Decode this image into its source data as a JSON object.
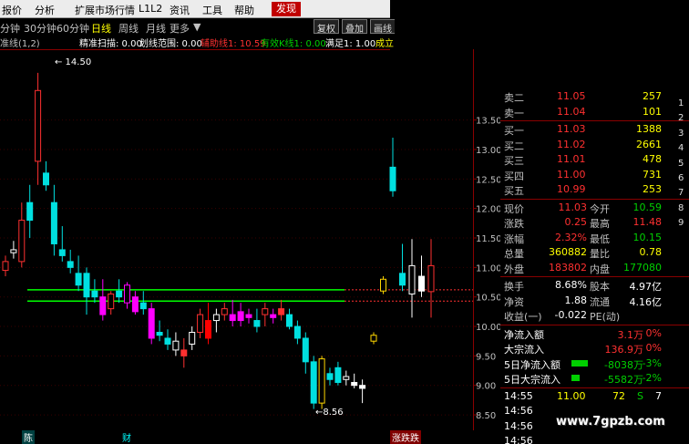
{
  "menu": [
    "报价",
    "分析",
    "扩展市场行情",
    "L1L2",
    "资讯",
    "工具",
    "帮助",
    "发现"
  ],
  "periods": [
    "分钟",
    "30分钟",
    "60分钟",
    "日线",
    "周线",
    "月线",
    "更多"
  ],
  "period_active": "日线",
  "toolbar": [
    "复权",
    "叠加",
    "画线"
  ],
  "indicator_bar": [
    {
      "text": "准线(1,2)",
      "color": "#c0c0c0"
    },
    {
      "text": "精准扫描: 0.00",
      "color": "#ffffff"
    },
    {
      "text": "划线范围: 0.00",
      "color": "#ffffff"
    },
    {
      "text": "辅助线1: 10.59",
      "color": "#ff3030"
    },
    {
      "text": "有效K线1: 0.00",
      "color": "#00d000"
    },
    {
      "text": "满足1: 1.00",
      "color": "#ffffff"
    },
    {
      "text": "成立",
      "color": "#ffff00"
    }
  ],
  "price_scale": [
    "13.50",
    "13.00",
    "12.50",
    "12.00",
    "11.50",
    "11.00",
    "10.50",
    "10.00",
    "9.50",
    "9.00",
    "8.50"
  ],
  "chart_labels": {
    "high": "14.50",
    "low": "8.56"
  },
  "quote": {
    "sell": [
      {
        "label": "卖二",
        "price": "11.05",
        "vol": "257"
      },
      {
        "label": "卖一",
        "price": "11.04",
        "vol": "101"
      }
    ],
    "buy": [
      {
        "label": "买一",
        "price": "11.03",
        "vol": "1388"
      },
      {
        "label": "买二",
        "price": "11.02",
        "vol": "2661"
      },
      {
        "label": "买三",
        "price": "11.01",
        "vol": "478"
      },
      {
        "label": "买四",
        "price": "11.00",
        "vol": "731"
      },
      {
        "label": "买五",
        "price": "10.99",
        "vol": "253"
      }
    ],
    "stats": [
      {
        "l1": "现价",
        "v1": "11.03",
        "c1": "#ff3030",
        "l2": "今开",
        "v2": "10.59",
        "c2": "#00d000"
      },
      {
        "l1": "涨跌",
        "v1": "0.25",
        "c1": "#ff3030",
        "l2": "最高",
        "v2": "11.48",
        "c2": "#ff3030"
      },
      {
        "l1": "涨幅",
        "v1": "2.32%",
        "c1": "#ff3030",
        "l2": "最低",
        "v2": "10.15",
        "c2": "#00d000"
      },
      {
        "l1": "总量",
        "v1": "360882",
        "c1": "#ffff00",
        "l2": "量比",
        "v2": "0.78",
        "c2": "#ffff00"
      },
      {
        "l1": "外盘",
        "v1": "183802",
        "c1": "#ff3030",
        "l2": "内盘",
        "v2": "177080",
        "c2": "#00d000"
      }
    ],
    "stats2": [
      {
        "l1": "换手",
        "v1": "8.68%",
        "c1": "#ffffff",
        "l2": "股本",
        "v2": "4.97亿",
        "c2": "#ffffff"
      },
      {
        "l1": "净资",
        "v1": "1.88",
        "c1": "#ffffff",
        "l2": "流通",
        "v2": "4.16亿",
        "c2": "#ffffff"
      },
      {
        "l1": "收益(一)",
        "v1": "-0.022",
        "c1": "#ffffff",
        "l2": "PE(动)",
        "v2": "",
        "c2": "#ffffff"
      }
    ],
    "flows": [
      {
        "label": "净流入额",
        "value": "3.1万",
        "pct": "0%",
        "color": "#ff3030",
        "bar": 0
      },
      {
        "label": "大宗流入",
        "value": "136.9万",
        "pct": "0%",
        "color": "#ff3030",
        "bar": 0
      },
      {
        "label": "5日净流入额",
        "value": "-8038万",
        "pct": "-3%",
        "color": "#00d000",
        "bar": 0.6
      },
      {
        "label": "5日大宗流入",
        "value": "-5582万",
        "pct": "-2%",
        "color": "#00d000",
        "bar": 0.3
      }
    ],
    "ticks": [
      {
        "time": "14:55",
        "price": "11.00",
        "vol": "72",
        "dir": "S",
        "count": "7"
      },
      {
        "time": "14:56",
        "price": "",
        "vol": "",
        "dir": "",
        "count": ""
      },
      {
        "time": "14:56",
        "price": "",
        "vol": "",
        "dir": "",
        "count": ""
      },
      {
        "time": "14:56",
        "price": "",
        "vol": "",
        "dir": "",
        "count": ""
      },
      {
        "time": "14:56",
        "price": "",
        "vol": "",
        "dir": "",
        "count": ""
      }
    ]
  },
  "right_edge": [
    "1",
    "2",
    "3",
    "4",
    "5",
    "6",
    "7",
    "8",
    "9"
  ],
  "bottom": [
    "陈",
    "财",
    "涨跌跌"
  ],
  "watermark": "www.7gpzb.com",
  "chart_data": {
    "type": "candlestick",
    "ylim": [
      8.3,
      14.7
    ],
    "hlines": [
      {
        "value": 10.62,
        "color": "#00ff00"
      },
      {
        "value": 10.43,
        "color": "#00ff00"
      }
    ],
    "candles": [
      {
        "o": 10.95,
        "h": 11.2,
        "l": 10.85,
        "c": 11.1,
        "col": "#ff3030"
      },
      {
        "o": 11.25,
        "h": 11.45,
        "l": 11.15,
        "c": 11.3,
        "col": "#ffffff"
      },
      {
        "o": 11.1,
        "h": 12.1,
        "l": 11.0,
        "c": 11.8,
        "col": "#ff3030"
      },
      {
        "o": 12.1,
        "h": 12.4,
        "l": 11.5,
        "c": 11.8,
        "col": "#00e0e0"
      },
      {
        "o": 12.8,
        "h": 14.3,
        "l": 12.4,
        "c": 14.0,
        "col": "#ff3030"
      },
      {
        "o": 12.6,
        "h": 12.8,
        "l": 12.3,
        "c": 12.4,
        "col": "#00e0e0"
      },
      {
        "o": 12.1,
        "h": 12.4,
        "l": 11.2,
        "c": 11.4,
        "col": "#00e0e0"
      },
      {
        "o": 11.3,
        "h": 11.7,
        "l": 11.1,
        "c": 11.2,
        "col": "#00e0e0"
      },
      {
        "o": 11.1,
        "h": 11.3,
        "l": 10.9,
        "c": 11.0,
        "col": "#00e0e0"
      },
      {
        "o": 10.9,
        "h": 11.2,
        "l": 10.6,
        "c": 10.7,
        "col": "#00e0e0"
      },
      {
        "o": 10.9,
        "h": 11.0,
        "l": 10.2,
        "c": 10.5,
        "col": "#00e0e0"
      },
      {
        "o": 10.6,
        "h": 10.8,
        "l": 10.4,
        "c": 10.5,
        "col": "#00e0e0"
      },
      {
        "o": 10.5,
        "h": 10.8,
        "l": 10.1,
        "c": 10.2,
        "col": "#ff00ff"
      },
      {
        "o": 10.3,
        "h": 10.6,
        "l": 10.2,
        "c": 10.55,
        "col": "#ff3030"
      },
      {
        "o": 10.6,
        "h": 10.8,
        "l": 10.4,
        "c": 10.5,
        "col": "#00e0e0"
      },
      {
        "o": 10.4,
        "h": 10.75,
        "l": 10.3,
        "c": 10.7,
        "col": "#ff00ff"
      },
      {
        "o": 10.5,
        "h": 10.6,
        "l": 10.2,
        "c": 10.25,
        "col": "#ff00ff"
      },
      {
        "o": 10.4,
        "h": 10.6,
        "l": 10.2,
        "c": 10.3,
        "col": "#00e0e0"
      },
      {
        "o": 10.3,
        "h": 10.4,
        "l": 9.7,
        "c": 9.8,
        "col": "#ff00ff"
      },
      {
        "o": 9.9,
        "h": 10.1,
        "l": 9.75,
        "c": 9.85,
        "col": "#00e0e0"
      },
      {
        "o": 9.8,
        "h": 9.95,
        "l": 9.6,
        "c": 9.7,
        "col": "#00e0e0"
      },
      {
        "o": 9.6,
        "h": 9.9,
        "l": 9.5,
        "c": 9.75,
        "col": "#ffffff"
      },
      {
        "o": 9.6,
        "h": 9.8,
        "l": 9.3,
        "c": 9.5,
        "col": "#ff3030"
      },
      {
        "o": 9.7,
        "h": 10.0,
        "l": 9.6,
        "c": 9.9,
        "col": "#ffffff"
      },
      {
        "o": 9.9,
        "h": 10.3,
        "l": 9.8,
        "c": 10.2,
        "col": "#ff3030"
      },
      {
        "o": 10.1,
        "h": 10.4,
        "l": 9.7,
        "c": 9.8,
        "col": "#ff0000"
      },
      {
        "o": 10.1,
        "h": 10.3,
        "l": 9.9,
        "c": 10.2,
        "col": "#ffffff"
      },
      {
        "o": 10.2,
        "h": 10.4,
        "l": 10.1,
        "c": 10.3,
        "col": "#ff3030"
      },
      {
        "o": 10.2,
        "h": 10.45,
        "l": 10.0,
        "c": 10.1,
        "col": "#ff00ff"
      },
      {
        "o": 10.25,
        "h": 10.4,
        "l": 10.0,
        "c": 10.1,
        "col": "#ff00ff"
      },
      {
        "o": 10.2,
        "h": 10.3,
        "l": 10.05,
        "c": 10.15,
        "col": "#ff00ff"
      },
      {
        "o": 10.1,
        "h": 10.3,
        "l": 9.9,
        "c": 10.0,
        "col": "#00e0e0"
      },
      {
        "o": 10.2,
        "h": 10.4,
        "l": 10.0,
        "c": 10.3,
        "col": "#ff3030"
      },
      {
        "o": 10.2,
        "h": 10.3,
        "l": 10.05,
        "c": 10.15,
        "col": "#ff00ff"
      },
      {
        "o": 10.3,
        "h": 10.45,
        "l": 10.1,
        "c": 10.2,
        "col": "#ff3030"
      },
      {
        "o": 10.2,
        "h": 10.3,
        "l": 9.95,
        "c": 10.0,
        "col": "#00e0e0"
      },
      {
        "o": 10.0,
        "h": 10.1,
        "l": 9.7,
        "c": 9.8,
        "col": "#00e0e0"
      },
      {
        "o": 9.8,
        "h": 9.9,
        "l": 9.2,
        "c": 9.4,
        "col": "#00e0e0"
      },
      {
        "o": 9.4,
        "h": 9.5,
        "l": 8.6,
        "c": 8.7,
        "col": "#00e0e0"
      },
      {
        "o": 8.7,
        "h": 9.5,
        "l": 8.6,
        "c": 9.45,
        "col": "#ffd700"
      },
      {
        "o": 9.2,
        "h": 9.3,
        "l": 9.0,
        "c": 9.1,
        "col": "#00e0e0"
      },
      {
        "o": 9.3,
        "h": 9.4,
        "l": 9.0,
        "c": 9.05,
        "col": "#00e0e0"
      },
      {
        "o": 9.1,
        "h": 9.25,
        "l": 9.0,
        "c": 9.15,
        "col": "#ffffff"
      },
      {
        "o": 9.05,
        "h": 9.2,
        "l": 8.95,
        "c": 9.0,
        "col": "#ffffff"
      },
      {
        "o": 9.0,
        "h": 9.1,
        "l": 8.7,
        "c": 8.95,
        "col": "#ffffff"
      },
      {
        "o": 9.75,
        "h": 9.9,
        "l": 9.7,
        "c": 9.85,
        "col": "#ffd700"
      },
      {
        "o": 10.6,
        "h": 10.85,
        "l": 10.55,
        "c": 10.8,
        "col": "#ffd700"
      },
      {
        "o": 12.7,
        "h": 13.2,
        "l": 12.2,
        "c": 12.3,
        "col": "#00e0e0"
      },
      {
        "o": 10.9,
        "h": 11.4,
        "l": 10.6,
        "c": 10.7,
        "col": "#00e0e0"
      },
      {
        "o": 10.55,
        "h": 11.48,
        "l": 10.15,
        "c": 11.03,
        "col": "#ffffff"
      },
      {
        "o": 10.85,
        "h": 11.2,
        "l": 10.5,
        "c": 10.6,
        "col": "#ffffff"
      },
      {
        "o": 10.59,
        "h": 11.48,
        "l": 10.15,
        "c": 11.03,
        "col": "#ff3030"
      }
    ]
  }
}
